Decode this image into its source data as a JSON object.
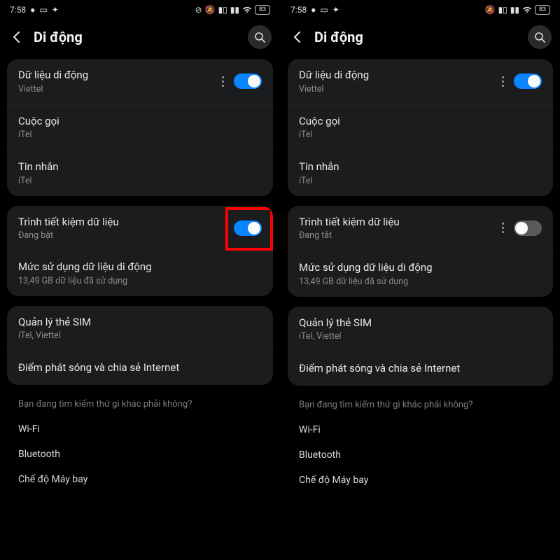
{
  "status": {
    "time": "7:58",
    "battery": "83"
  },
  "header": {
    "title": "Di động"
  },
  "card1": {
    "mobile_data": {
      "title": "Dữ liệu di động",
      "sub": "Viettel"
    },
    "calls": {
      "title": "Cuộc gọi",
      "sub": "iTel"
    },
    "messages": {
      "title": "Tin nhắn",
      "sub": "iTel"
    }
  },
  "card2_left": {
    "data_saver": {
      "title": "Trình tiết kiệm dữ liệu",
      "sub": "Đang bật"
    },
    "usage": {
      "title": "Mức sử dụng dữ liệu di động",
      "sub": "13,49 GB dữ liệu đã sử dụng"
    }
  },
  "card2_right": {
    "data_saver": {
      "title": "Trình tiết kiệm dữ liệu",
      "sub": "Đang tắt"
    },
    "usage": {
      "title": "Mức sử dụng dữ liệu di động",
      "sub": "13,49 GB dữ liệu đã sử dụng"
    }
  },
  "card3": {
    "sim": {
      "title": "Quản lý thẻ SIM",
      "sub": "iTel, Viettel"
    },
    "hotspot": {
      "title": "Điểm phát sóng và chia sẻ Internet"
    }
  },
  "footer": {
    "hint": "Bạn đang tìm kiếm thứ gì khác phải không?",
    "wifi": "Wi-Fi",
    "bt": "Bluetooth",
    "air": "Chế độ Máy bay"
  }
}
